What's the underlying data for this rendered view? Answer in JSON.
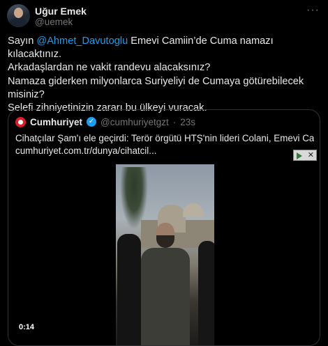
{
  "author": {
    "name": "Uğur Emek",
    "handle": "@uemek"
  },
  "menu_icon": "more-horizontal-icon",
  "tweet": {
    "line1_prefix": "Sayın ",
    "mention": "@Ahmet_Davutoglu",
    "line1_suffix": " Emevi Camiin’de Cuma namazı kılacaktınız.",
    "line2": "Arkadaşlardan ne vakit randevu alacaksınız?",
    "line3": "Namaza giderken milyonlarca Suriyeliyi de Cumaya götürebilecek misiniz?",
    "line4": "Selefi zihniyetinizin zararı bu ülkeyi vuracak."
  },
  "quote": {
    "name": "Cumhuriyet",
    "handle": "@cumhuriyetgzt",
    "separator": "·",
    "time": "23s",
    "text_line1": "Cihatçılar Şam'ı ele geçirdi: Terör örgütü HTŞ'nin lideri Colani, Emevi Camii'nde",
    "text_line2": "cumhuriyet.com.tr/dunya/cihatcil...",
    "video_timestamp": "0:14"
  },
  "colors": {
    "background": "#000000",
    "text": "#e7e9ea",
    "muted": "#71767b",
    "link": "#1d9bf0",
    "border": "#2f3336",
    "brand_red": "#d62027"
  }
}
